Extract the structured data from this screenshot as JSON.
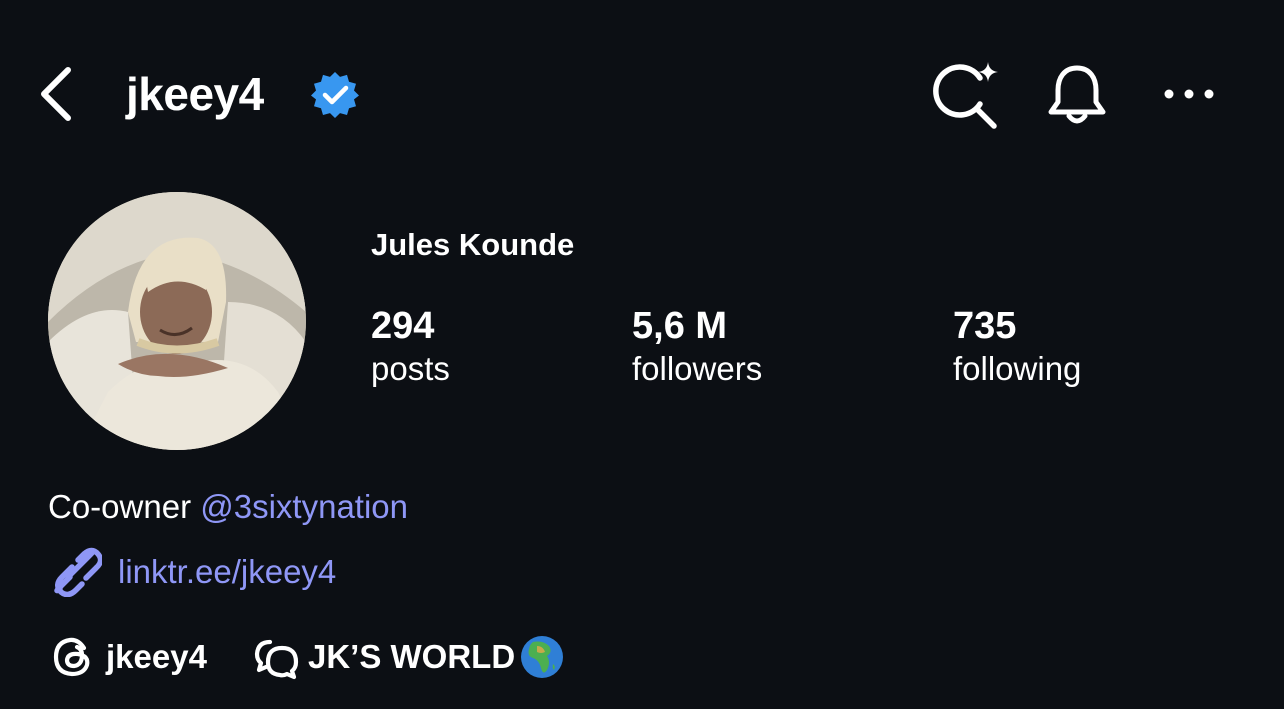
{
  "header": {
    "username": "jkeey4",
    "icons": {
      "back": "chevron-left-icon",
      "verified": "verified-badge-icon",
      "search": "search-sparkle-icon",
      "bell": "bell-icon",
      "more": "more-horizontal-icon"
    }
  },
  "profile": {
    "full_name": "Jules Kounde",
    "stats": {
      "posts": {
        "value": "294",
        "label": "posts"
      },
      "followers": {
        "value": "5,6 M",
        "label": "followers"
      },
      "following": {
        "value": "735",
        "label": "following"
      }
    }
  },
  "bio": {
    "prefix": "Co-owner ",
    "mention": "@3sixtynation",
    "link": "linktr.ee/jkeey4"
  },
  "badges": {
    "threads": {
      "icon": "threads-icon",
      "label": "jkeey4"
    },
    "channel": {
      "icon": "broadcast-channel-icon",
      "label": "JK’S WORLD",
      "emoji": "globe-africa-icon"
    }
  },
  "colors": {
    "background": "#0c0f14",
    "text": "#ffffff",
    "link": "#8f97f6",
    "verified": "#3897f0"
  }
}
